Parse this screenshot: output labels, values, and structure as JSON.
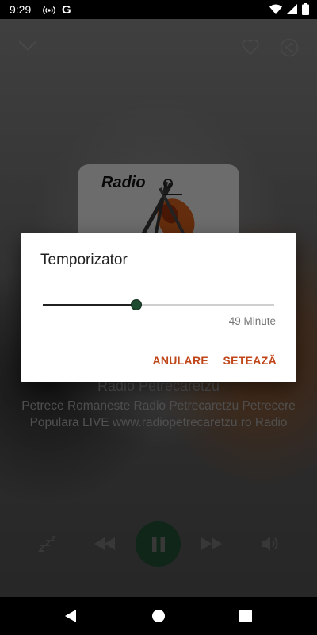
{
  "status_bar": {
    "time": "9:29",
    "google_glyph": "G"
  },
  "player": {
    "art_text": "Radio",
    "station_title": "Radio Petrecaretzu",
    "station_description": "Petrece Romaneste Radio Petrecaretzu Petrecere Populara LIVE www.radiopetrecaretzu.ro Radio",
    "accent_color": "#1e4a30"
  },
  "dialog": {
    "title": "Temporizator",
    "value_label": "49 Minute",
    "slider_value_minutes": 49,
    "slider_fraction": 0.4,
    "cancel_label": "ANULARE",
    "set_label": "SETEAZĂ",
    "button_color": "#c0461a"
  },
  "icons": {
    "collapse": "chevron-down-icon",
    "favorite": "heart-outline-icon",
    "share": "share-icon",
    "sleep": "sleep-zzz-icon",
    "previous": "rewind-icon",
    "pause": "pause-icon",
    "next": "fast-forward-icon",
    "volume": "volume-icon"
  }
}
